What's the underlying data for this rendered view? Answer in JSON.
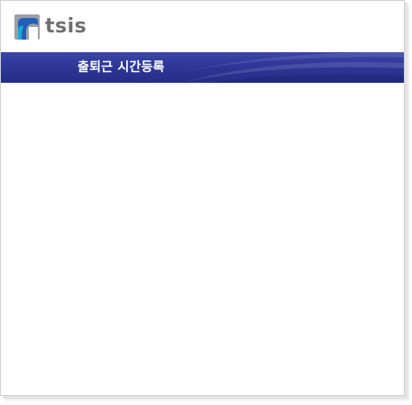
{
  "header": {
    "logo_text": "tsis",
    "brand_colors": {
      "mark_gray": "#9aa0a8",
      "mark_blue": "#1f5fb8",
      "mark_cyan": "#19a8d8",
      "text_gray": "#6f6f6f"
    }
  },
  "title_bar": {
    "title": "출퇴근 시간등록",
    "background": "#2e3797"
  }
}
